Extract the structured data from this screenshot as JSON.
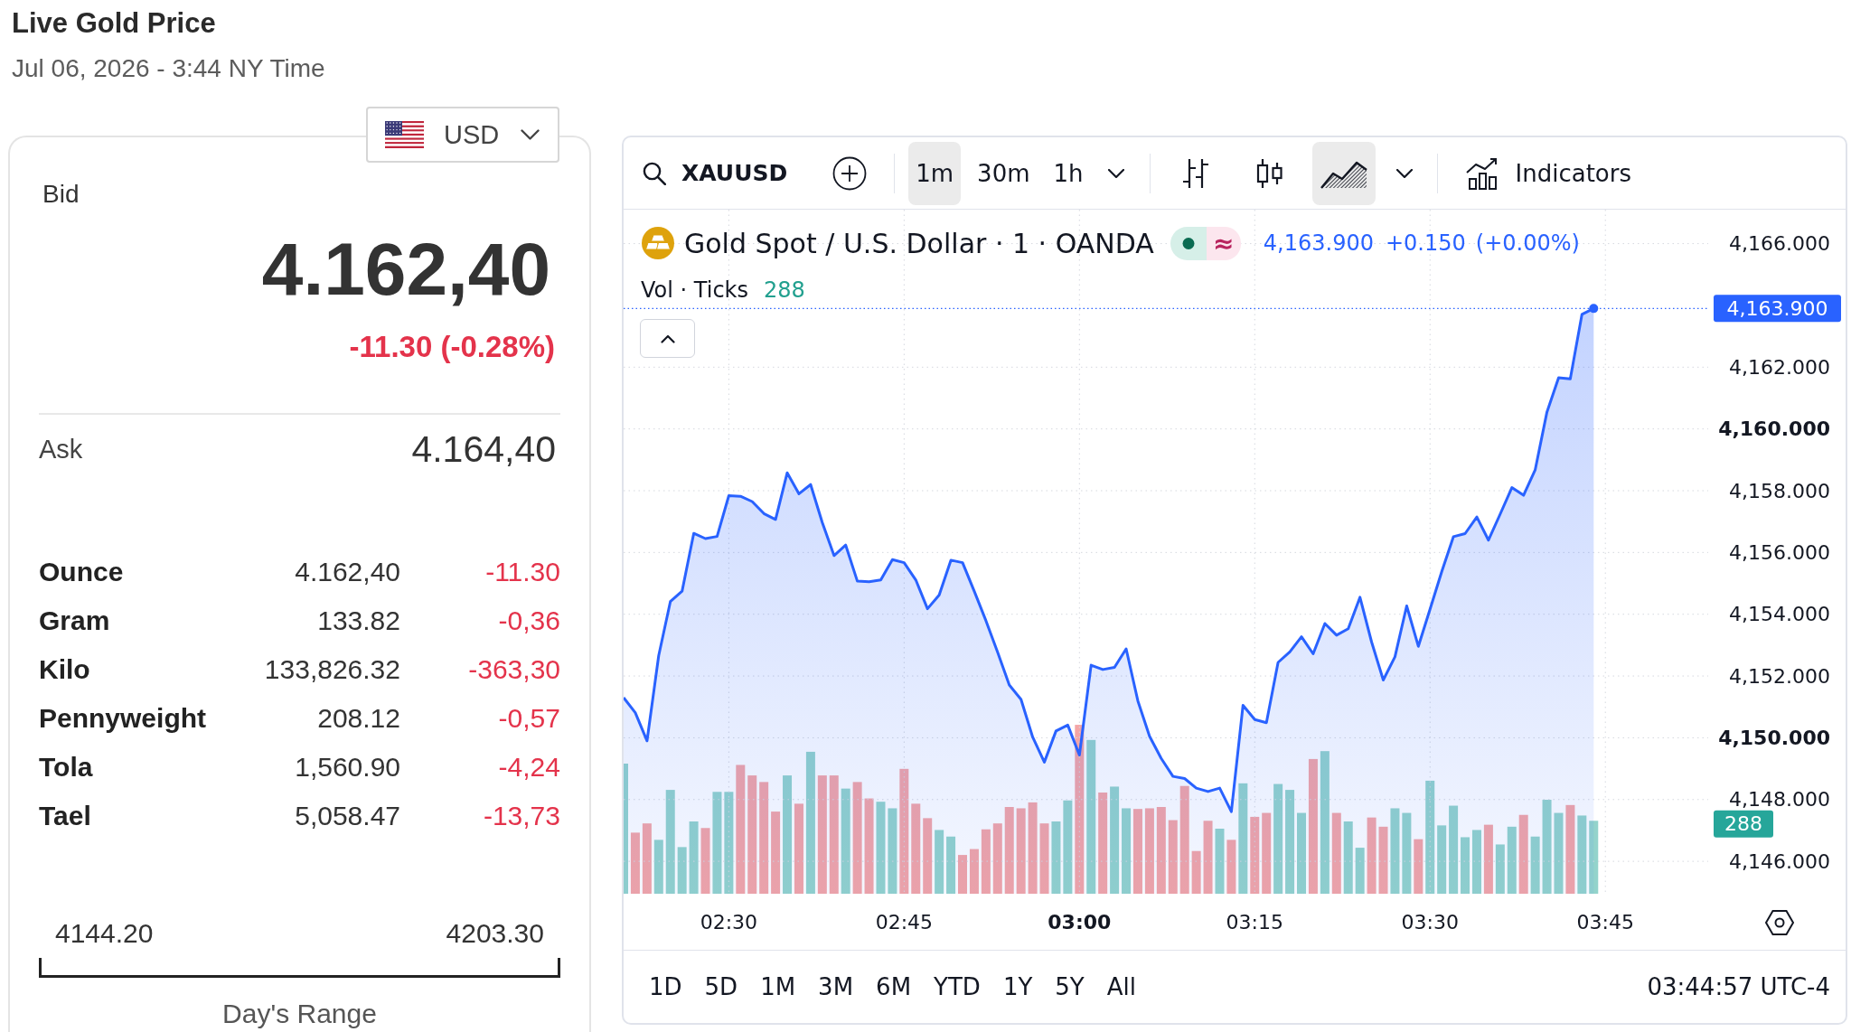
{
  "header": {
    "title": "Live Gold Price",
    "timestamp": "Jul 06, 2026 - 3:44 NY Time"
  },
  "quote_card": {
    "currency": {
      "code": "USD"
    },
    "bid": {
      "label": "Bid",
      "value": "4.162,40",
      "change": "-11.30 (-0.28%)",
      "falling": true
    },
    "ask": {
      "label": "Ask",
      "value": "4.164,40"
    },
    "units": [
      {
        "name": "Ounce",
        "price": "4.162,40",
        "change": "-11.30",
        "falling": true
      },
      {
        "name": "Gram",
        "price": "133.82",
        "change": "-0,36",
        "falling": true
      },
      {
        "name": "Kilo",
        "price": "133,826.32",
        "change": "-363,30",
        "falling": true
      },
      {
        "name": "Pennyweight",
        "price": "208.12",
        "change": "-0,57",
        "falling": true
      },
      {
        "name": "Tola",
        "price": "1,560.90",
        "change": "-4,24",
        "falling": true
      },
      {
        "name": "Tael",
        "price": "5,058.47",
        "change": "-13,73",
        "falling": true
      }
    ],
    "day_range": {
      "low": "4144.20",
      "high": "4203.30",
      "label": "Day's Range"
    }
  },
  "chart": {
    "toolbar": {
      "symbol": "XAUUSD",
      "intervals": [
        {
          "label": "1m",
          "selected": true
        },
        {
          "label": "30m",
          "selected": false
        },
        {
          "label": "1h",
          "selected": false
        }
      ],
      "chart_types": [
        {
          "kind": "bars",
          "selected": false
        },
        {
          "kind": "candles",
          "selected": false
        },
        {
          "kind": "area",
          "selected": true
        }
      ],
      "indicators_label": "Indicators"
    },
    "legend": {
      "title": "Gold Spot / U.S. Dollar · 1 · OANDA",
      "status_symbol": "≈",
      "last": "4,163.900",
      "change": "+0.150",
      "change_percent": "(+0.00%)",
      "volume_title": "Vol · Ticks",
      "volume": "288"
    },
    "chart_data": {
      "type": "area",
      "grid": true,
      "x": [
        141,
        142,
        143,
        144,
        145,
        146,
        147,
        148,
        149,
        150,
        151,
        152,
        153,
        154,
        155,
        156,
        157,
        158,
        159,
        160,
        161,
        162,
        163,
        164,
        165,
        166,
        167,
        168,
        169,
        170,
        171,
        172,
        173,
        174,
        175,
        176,
        177,
        178,
        179,
        180,
        181,
        182,
        183,
        184,
        185,
        186,
        187,
        188,
        189,
        190,
        191,
        192,
        193,
        194,
        195,
        196,
        197,
        198,
        199,
        200,
        201,
        202,
        203,
        204,
        205,
        206,
        207,
        208,
        209,
        210,
        211,
        212,
        213,
        214,
        215,
        216,
        217,
        218,
        219,
        220,
        221,
        222,
        223,
        224
      ],
      "series": [
        {
          "color": "#2962ff",
          "values": [
            4151.3,
            4150.81,
            4149.9,
            4152.66,
            4154.41,
            4154.75,
            4156.62,
            4156.45,
            4156.52,
            4157.84,
            4157.82,
            4157.65,
            4157.26,
            4157.07,
            4158.58,
            4157.9,
            4158.2,
            4156.97,
            4155.9,
            4156.24,
            4155.07,
            4155.05,
            4155.11,
            4155.77,
            4155.67,
            4155.11,
            4154.18,
            4154.62,
            4155.75,
            4155.67,
            4154.75,
            4153.79,
            4152.77,
            4151.71,
            4151.24,
            4150.02,
            4149.21,
            4150.22,
            4150.41,
            4149.44,
            4152.35,
            4152.21,
            4152.28,
            4152.88,
            4151.19,
            4150.05,
            4149.33,
            4148.75,
            4148.68,
            4148.37,
            4148.26,
            4148.37,
            4147.61,
            4151.05,
            4150.59,
            4150.49,
            4152.44,
            4152.78,
            4153.27,
            4152.72,
            4153.7,
            4153.32,
            4153.53,
            4154.55,
            4153.1,
            4151.87,
            4152.62,
            4154.27,
            4152.96,
            4154.16,
            4155.38,
            4156.51,
            4156.61,
            4157.15,
            4156.4,
            4157.24,
            4158.1,
            4157.85,
            4158.68,
            4160.55,
            4161.66,
            4161.62,
            4163.71,
            4163.9
          ]
        }
      ],
      "xlim": [
        141,
        233.8
      ],
      "ylim": [
        4144.95,
        4167.1
      ],
      "xticks": [
        {
          "value": 150,
          "label": "02:30"
        },
        {
          "value": 165,
          "label": "02:45"
        },
        {
          "value": 180,
          "label": "03:00"
        },
        {
          "value": 195,
          "label": "03:15"
        },
        {
          "value": 210,
          "label": "03:30"
        },
        {
          "value": 225,
          "label": "03:45"
        }
      ],
      "yticks": [
        {
          "value": 4166,
          "label": "4,166.000"
        },
        {
          "value": 4162,
          "label": "4,162.000"
        },
        {
          "value": 4160,
          "label": "4,160.000"
        },
        {
          "value": 4158,
          "label": "4,158.000"
        },
        {
          "value": 4156,
          "label": "4,156.000"
        },
        {
          "value": 4154,
          "label": "4,154.000"
        },
        {
          "value": 4152,
          "label": "4,152.000"
        },
        {
          "value": 4150,
          "label": "4,150.000"
        },
        {
          "value": 4148,
          "label": "4,148.000"
        },
        {
          "value": 4146,
          "label": "4,146.000"
        }
      ]
    },
    "last_price_tag": "4,163.900",
    "last_volume_tag": "288",
    "ranges": [
      "1D",
      "5D",
      "1M",
      "3M",
      "6M",
      "YTD",
      "1Y",
      "5Y",
      "All"
    ],
    "clock": "03:44:57 UTC-4"
  }
}
